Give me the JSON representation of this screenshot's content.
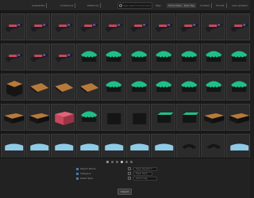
{
  "toolbar": {
    "filters": [
      {
        "label": "Availability"
      },
      {
        "label": "Collections"
      },
      {
        "label": "Platforms"
      },
      {
        "label": "Features"
      }
    ],
    "search_placeholder": "Type search terms here",
    "tags": [
      "Tags",
      "Show Mask",
      "New Tag"
    ],
    "sort_label": "Last updated",
    "right_filters": [
      {
        "label": "Created"
      },
      {
        "label": "Format"
      }
    ]
  },
  "tiles": {
    "rows": [
      [
        "weapon",
        "weapon",
        "weapon",
        "weapon",
        "weapon",
        "weapon",
        "weapon",
        "weapon",
        "weapon",
        "weapon"
      ],
      [
        "weapon",
        "weapon",
        "weapon",
        "blob",
        "blob",
        "blob",
        "blob",
        "blob",
        "blob",
        "blob"
      ],
      [
        "cube",
        "slab",
        "slab",
        "slab",
        "blob",
        "blob",
        "blob",
        "blob",
        "blob",
        "blob"
      ],
      [
        "crate",
        "crate",
        "pink",
        "blob",
        "cube-dark",
        "cube-dark",
        "cube-green",
        "cube-green",
        "crate",
        "crate"
      ],
      [
        "ice",
        "ice",
        "ice",
        "ice",
        "ice",
        "ice",
        "ice",
        "ring",
        "ring",
        "ice"
      ]
    ]
  },
  "bottombar": {
    "page_indicator_count": 6,
    "active_page": 3,
    "rows": [
      {
        "label": "Object Name"
      },
      {
        "label": "Category"
      },
      {
        "label": "Asset Type"
      }
    ],
    "fields": [
      "Type keyword",
      "Type here",
      "Add a tag"
    ],
    "apply_label": "Import"
  },
  "colors": {
    "green": "#1fbf8a",
    "orange": "#b87a3a",
    "pink": "#c8485c",
    "ice": "#8fcbe6",
    "dark": "#151515",
    "accent": "#4a78b0"
  }
}
